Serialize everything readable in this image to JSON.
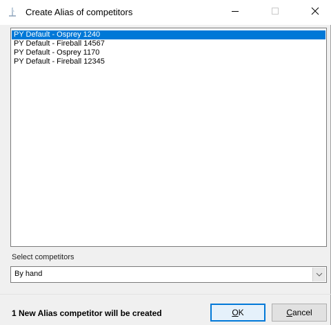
{
  "window": {
    "title": "Create Alias of competitors"
  },
  "competitor_list": {
    "items": [
      {
        "label": "PY Default - Osprey 1240",
        "selected": true
      },
      {
        "label": "PY Default - Fireball 14567",
        "selected": false
      },
      {
        "label": "PY Default - Osprey 1170",
        "selected": false
      },
      {
        "label": "PY Default - Fireball 12345",
        "selected": false
      }
    ]
  },
  "select_competitors": {
    "label": "Select competitors",
    "value": "By hand"
  },
  "footer": {
    "info": "1 New Alias competitor will be created",
    "ok_mnemonic": "O",
    "ok_rest": "K",
    "cancel_mnemonic": "C",
    "cancel_rest": "ancel"
  },
  "colors": {
    "selection": "#0078d7",
    "dialog_bg": "#f0f0f0"
  },
  "icons": {
    "app": "app-icon",
    "minimize": "minimize-icon",
    "maximize": "maximize-icon",
    "close": "close-icon",
    "dropdown": "chevron-down-icon"
  }
}
